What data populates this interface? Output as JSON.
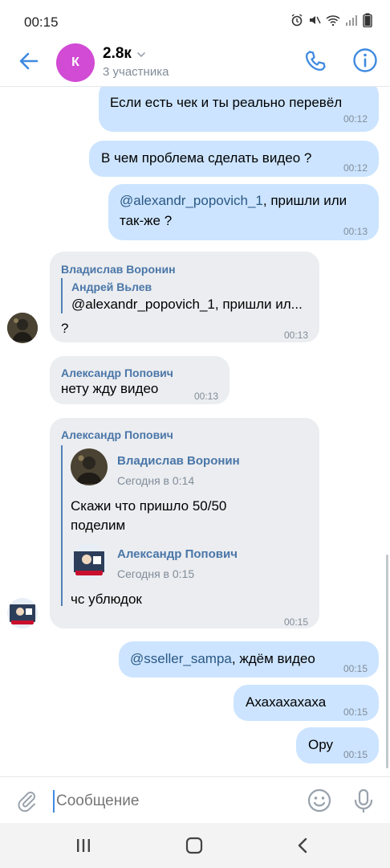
{
  "status_bar": {
    "time": "00:15",
    "icons": [
      "alarm-icon",
      "mute-icon",
      "wifi-icon",
      "signal-icon",
      "battery-icon"
    ]
  },
  "header": {
    "avatar_letter": "К",
    "title": "2.8к",
    "subtitle": "3 участника"
  },
  "messages": {
    "m1": {
      "text": "Если есть чек и ты реально перевёл",
      "time": "00:12"
    },
    "m2": {
      "text": "В чем проблема сделать видео ?",
      "time": "00:12"
    },
    "m3": {
      "mention": "@alexandr_popovich_1",
      "text_after": ", пришли или",
      "text_line2": "так-же ?",
      "time": "00:13"
    },
    "m4": {
      "sender": "Владислав Воронин",
      "reply_author": "Андрей Вьлев",
      "reply_text": "@alexandr_popovich_1, пришли ил...",
      "text": "?",
      "time": "00:13"
    },
    "m5": {
      "sender": "Александр Попович",
      "text": "нету жду видео",
      "time": "00:13"
    },
    "m6": {
      "sender": "Александр Попович",
      "fwd1_author": "Владислав Воронин",
      "fwd1_date": "Сегодня в 0:14",
      "fwd1_text_l1": "Скажи что пришло 50/50",
      "fwd1_text_l2": "поделим",
      "fwd2_author": "Александр Попович",
      "fwd2_date": "Сегодня в 0:15",
      "fwd2_text": "чс ублюдок",
      "time": "00:15"
    },
    "m7": {
      "mention": "@sseller_sampa",
      "text_after": ", ждём видео",
      "time": "00:15"
    },
    "m8": {
      "text": "Ахахахахаха",
      "time": "00:15"
    },
    "m9": {
      "text": "Ору",
      "time": "00:15"
    }
  },
  "composer": {
    "placeholder": "Сообщение"
  },
  "colors": {
    "outgoing_bubble": "#cce4ff",
    "incoming_bubble": "#ebedf0",
    "accent": "#3f8ae0",
    "sender_name": "#4a76a8",
    "time": "#818c99"
  }
}
